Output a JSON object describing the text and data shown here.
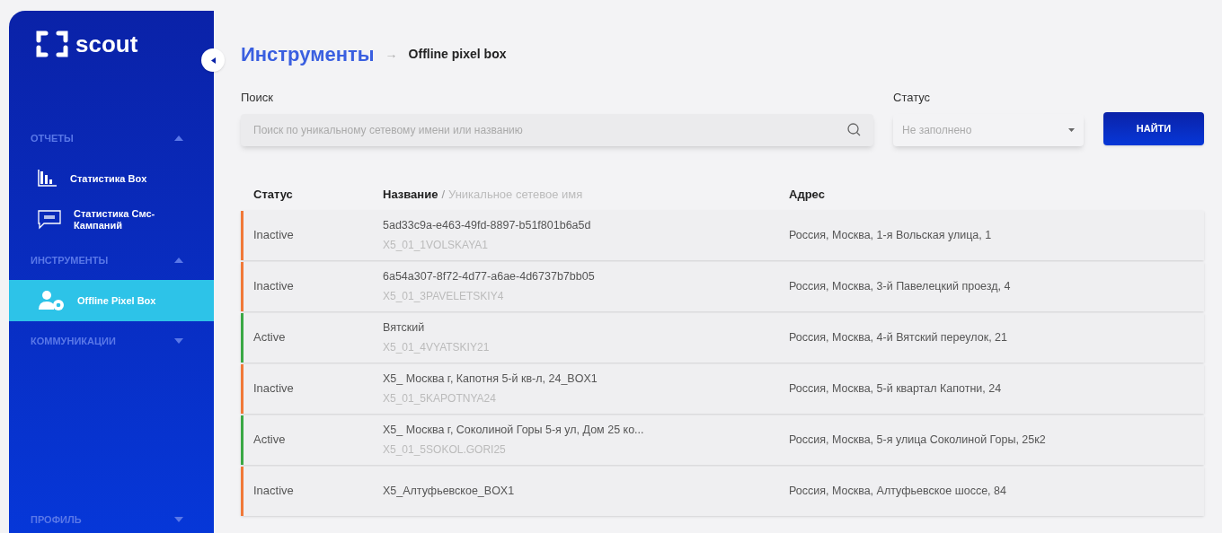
{
  "sidebar": {
    "logo": "scout",
    "sections": [
      {
        "title": "ОТЧЕТЫ",
        "expanded": true,
        "items": [
          {
            "label": "Статистика Box",
            "kind": "chart",
            "selected": false
          },
          {
            "label": "Статистика Смс-Кампаний",
            "kind": "sms",
            "selected": false
          }
        ]
      },
      {
        "title": "ИНСТРУМЕНТЫ",
        "expanded": true,
        "items": [
          {
            "label": "Offline Pixel Box",
            "kind": "users",
            "selected": true
          }
        ]
      },
      {
        "title": "КОММУНИКАЦИИ",
        "expanded": false
      }
    ],
    "footer": {
      "title": "ПРОФИЛЬ",
      "expanded": false
    }
  },
  "breadcrumb": {
    "root": "Инструменты",
    "arrow": "→",
    "current": "Offline pixel box"
  },
  "filters": {
    "search": {
      "label": "Поиск",
      "placeholder": "Поиск по уникальному сетевому имени или названию"
    },
    "status": {
      "label": "Статус",
      "placeholder": "Не заполнено"
    },
    "button": "НАЙТИ"
  },
  "table": {
    "columns": {
      "status": "Статус",
      "name": "Название",
      "name_separator": "/",
      "name_secondary": "Уникальное сетевое имя",
      "address": "Адрес"
    },
    "rows": [
      {
        "status": "Inactive",
        "color": "#f07838",
        "name": "5ad33c9a-e463-49fd-8897-b51f801b6a5d",
        "network_name": "X5_01_1VOLSKAYA1",
        "address": "Россия, Москва, 1-я Вольская улица, 1"
      },
      {
        "status": "Inactive",
        "color": "#f07838",
        "name": "6a54a307-8f72-4d77-a6ae-4d6737b7bb05",
        "network_name": "X5_01_3PAVELETSKIY4",
        "address": "Россия, Москва, 3-й Павелецкий проезд, 4"
      },
      {
        "status": "Active",
        "color": "#3aa845",
        "name": "Вятский",
        "network_name": "X5_01_4VYATSKIY21",
        "address": "Россия, Москва, 4-й Вятский переулок, 21"
      },
      {
        "status": "Inactive",
        "color": "#f07838",
        "name": "X5_ Москва г, Капотня 5-й кв-л, 24_BOX1",
        "network_name": "X5_01_5KAPOTNYA24",
        "address": "Россия, Москва, 5-й квартал Капотни, 24"
      },
      {
        "status": "Active",
        "color": "#3aa845",
        "name": "X5_ Москва г, Соколиной Горы 5-я ул, Дом 25 ко...",
        "network_name": "X5_01_5SOKOL.GORI25",
        "address": "Россия, Москва, 5-я улица Соколиной Горы, 25к2"
      },
      {
        "status": "Inactive",
        "color": "#f07838",
        "name": "X5_Алтуфьевское_BOX1",
        "address": "Россия, Москва, Алтуфьевское шоссе, 84"
      }
    ]
  }
}
